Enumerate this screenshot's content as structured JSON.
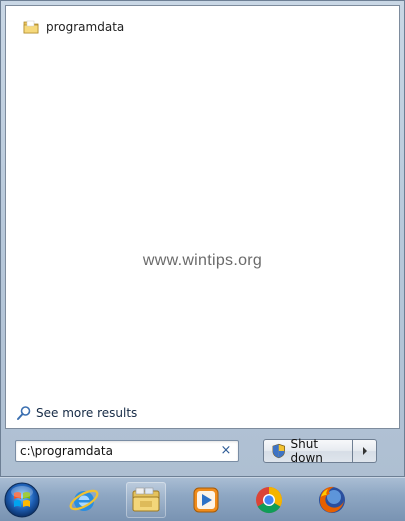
{
  "results": {
    "items": [
      {
        "label": "programdata",
        "icon": "folder-icon"
      }
    ],
    "see_more_label": "See more results"
  },
  "watermark": "www.wintips.org",
  "search": {
    "value": "c:\\programdata",
    "clear_glyph": "×"
  },
  "shutdown": {
    "label": "Shut down"
  },
  "taskbar": {
    "items": [
      {
        "name": "start-orb",
        "icon": "windows-logo-icon"
      },
      {
        "name": "internet-explorer",
        "icon": "ie-icon"
      },
      {
        "name": "windows-explorer",
        "icon": "folder-library-icon"
      },
      {
        "name": "media-player",
        "icon": "media-player-icon"
      },
      {
        "name": "chrome",
        "icon": "chrome-icon"
      },
      {
        "name": "firefox",
        "icon": "firefox-icon"
      }
    ]
  },
  "colors": {
    "link": "#152a45",
    "clear_x": "#2d5b96",
    "taskbar_top": "#a9bdd4",
    "taskbar_bottom": "#7993b2"
  }
}
